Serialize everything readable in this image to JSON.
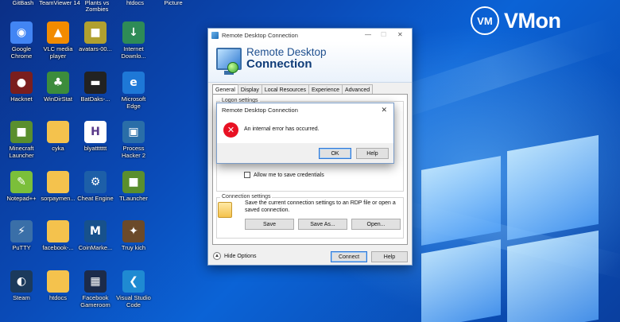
{
  "brand": {
    "badge": "VM",
    "name": "VMon"
  },
  "desktop": {
    "top_partial_labels": [
      "GitBash",
      "TeamViewer 14",
      "Plants vs Zombies",
      "htdocs",
      "Picture"
    ],
    "icons": [
      {
        "label": "Google Chrome",
        "icon": "chrome-icon",
        "color": "#4285f4",
        "glyph": "◉"
      },
      {
        "label": "VLC media player",
        "icon": "vlc-cone-icon",
        "color": "#f28b00",
        "glyph": "▲"
      },
      {
        "label": "avatars-00...",
        "icon": "car-image-icon",
        "color": "#b0a030",
        "glyph": "■"
      },
      {
        "label": "Internet Downlo...",
        "icon": "idm-icon",
        "color": "#2e8b57",
        "glyph": "↓"
      },
      {
        "label": "Hacknet",
        "icon": "hacknet-icon",
        "color": "#7a1e1e",
        "glyph": "●"
      },
      {
        "label": "WinDirStat",
        "icon": "tree-icon",
        "color": "#3c8c3c",
        "glyph": "♣"
      },
      {
        "label": "BatDaks-...",
        "icon": "keyboard-icon",
        "color": "#222222",
        "glyph": "▬"
      },
      {
        "label": "Microsoft Edge",
        "icon": "edge-icon",
        "color": "#1e78d7",
        "glyph": "e"
      },
      {
        "label": "Minecraft Launcher",
        "icon": "minecraft-icon",
        "color": "#5a8f2e",
        "glyph": "■"
      },
      {
        "label": "cyka",
        "icon": "folder-icon",
        "color": "#f4c24d",
        "glyph": ""
      },
      {
        "label": "blyattttttt",
        "icon": "document-h-icon",
        "color": "#ffffff",
        "glyph": "H"
      },
      {
        "label": "Process Hacker 2",
        "icon": "process-hacker-icon",
        "color": "#2a6ea8",
        "glyph": "▣"
      },
      {
        "label": "Notepad++",
        "icon": "notepadpp-icon",
        "color": "#7bbf3a",
        "glyph": "✎"
      },
      {
        "label": "sorpaymen...",
        "icon": "folder-icon",
        "color": "#f4c24d",
        "glyph": ""
      },
      {
        "label": "Cheat Engine",
        "icon": "cheat-engine-icon",
        "color": "#1d5fa8",
        "glyph": "⚙"
      },
      {
        "label": "TLauncher",
        "icon": "tlauncher-icon",
        "color": "#5a8f2e",
        "glyph": "■"
      },
      {
        "label": "PuTTY",
        "icon": "putty-icon",
        "color": "#3a6fa8",
        "glyph": "⚡"
      },
      {
        "label": "facebook-...",
        "icon": "folder-icon",
        "color": "#f4c24d",
        "glyph": ""
      },
      {
        "label": "CoinMarke...",
        "icon": "coinmarketcap-icon",
        "color": "#17518c",
        "glyph": "M"
      },
      {
        "label": "Truy kich",
        "icon": "game-icon",
        "color": "#6b4a2a",
        "glyph": "✦"
      },
      {
        "label": "Steam",
        "icon": "steam-icon",
        "color": "#1b3a5c",
        "glyph": "◐"
      },
      {
        "label": "htdocs",
        "icon": "folder-icon",
        "color": "#f4c24d",
        "glyph": ""
      },
      {
        "label": "Facebook Gameroom",
        "icon": "gameroom-icon",
        "color": "#1c2b4a",
        "glyph": "▦"
      },
      {
        "label": "Visual Studio Code",
        "icon": "vscode-icon",
        "color": "#1f8ad2",
        "glyph": "❮"
      }
    ]
  },
  "rdp": {
    "window_title": "Remote Desktop Connection",
    "banner_line1": "Remote Desktop",
    "banner_line2": "Connection",
    "tabs": [
      "General",
      "Display",
      "Local Resources",
      "Experience",
      "Advanced"
    ],
    "logon_group": "Logon settings",
    "allow_save_label": "Allow me to save credentials",
    "allow_save_checked": false,
    "conn_group": "Connection settings",
    "conn_desc": "Save the current connection settings to an RDP file or open a saved connection.",
    "save": "Save",
    "save_as": "Save As...",
    "open": "Open...",
    "hide_options": "Hide Options",
    "connect": "Connect",
    "help": "Help"
  },
  "error_dialog": {
    "title": "Remote Desktop Connection",
    "message": "An internal error has occurred.",
    "ok": "OK",
    "help": "Help"
  }
}
